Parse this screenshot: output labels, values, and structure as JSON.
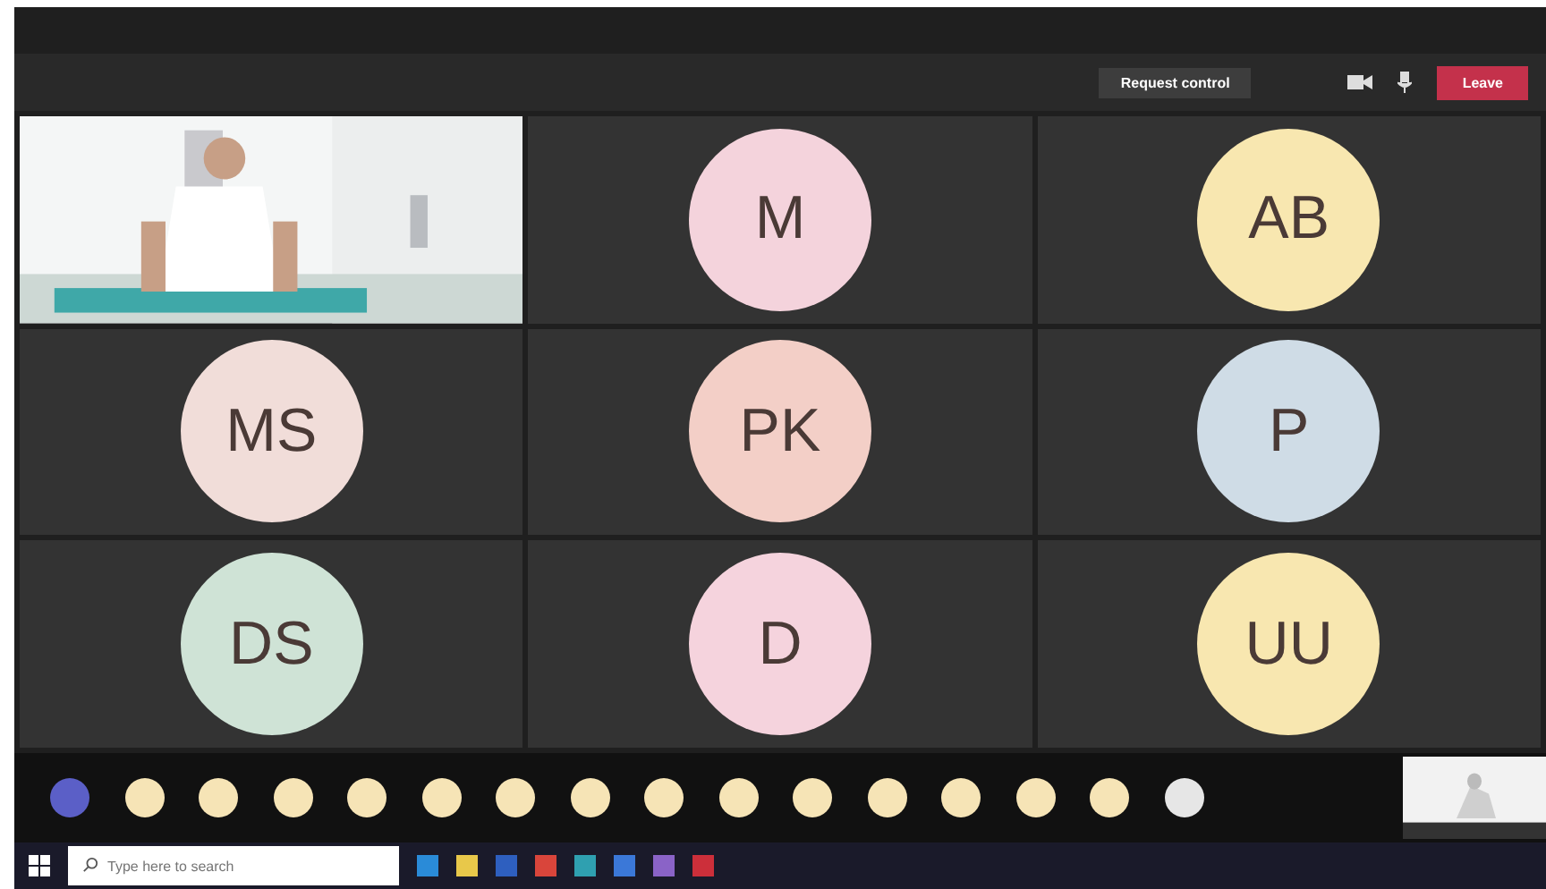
{
  "toolbar": {
    "request_button": "Request control",
    "leave_button": "Leave"
  },
  "tiles": [
    {
      "kind": "video"
    },
    {
      "kind": "avatar",
      "initials": "M",
      "color": "#f4d3dc"
    },
    {
      "kind": "avatar",
      "initials": "AB",
      "color": "#f8e7b0"
    },
    {
      "kind": "avatar",
      "initials": "MS",
      "color": "#f1ddd9"
    },
    {
      "kind": "avatar",
      "initials": "PK",
      "color": "#f3cfc7"
    },
    {
      "kind": "avatar",
      "initials": "P",
      "color": "#cfdce6"
    },
    {
      "kind": "avatar",
      "initials": "DS",
      "color": "#cfe3d6"
    },
    {
      "kind": "avatar",
      "initials": "D",
      "color": "#f5d3dd"
    },
    {
      "kind": "avatar",
      "initials": "UU",
      "color": "#f8e7b0"
    }
  ],
  "strip": [
    {
      "color": "#5b5fc7"
    },
    {
      "color": "#f6e4b6"
    },
    {
      "color": "#f6e4b6"
    },
    {
      "color": "#f6e4b6"
    },
    {
      "color": "#f6e4b6"
    },
    {
      "color": "#f6e4b6"
    },
    {
      "color": "#f6e4b6"
    },
    {
      "color": "#f6e4b6"
    },
    {
      "color": "#f6e4b6"
    },
    {
      "color": "#f6e4b6"
    },
    {
      "color": "#f6e4b6"
    },
    {
      "color": "#f6e4b6"
    },
    {
      "color": "#f6e4b6"
    },
    {
      "color": "#f6e4b6"
    },
    {
      "color": "#f6e4b6"
    },
    {
      "color": "#e6e6e6"
    }
  ],
  "taskbar": {
    "search": {
      "placeholder": "Type here to search"
    }
  }
}
